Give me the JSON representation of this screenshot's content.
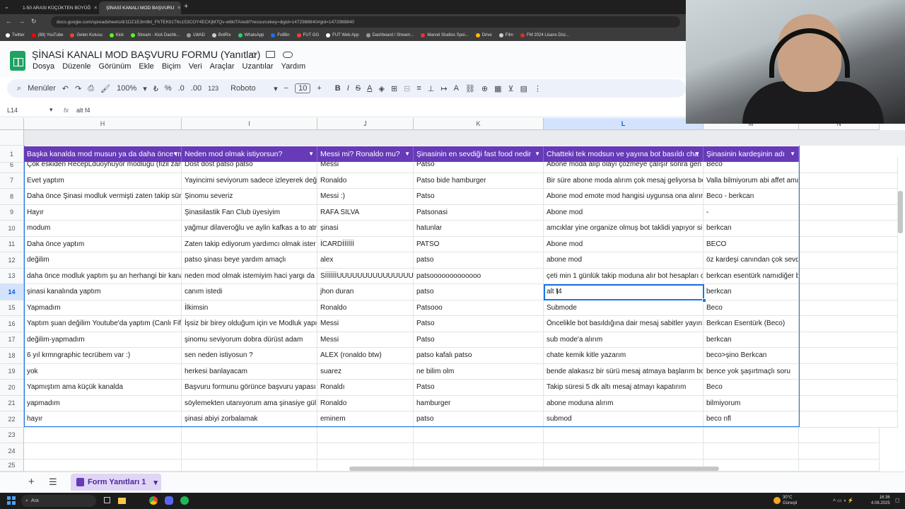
{
  "browser": {
    "tabs": [
      {
        "label": "1-50 ARASI KÜÇÜKTEN BÜYÜĞ",
        "active": false
      },
      {
        "label": "ŞİNASİ KANALI MOD BAŞVURU",
        "active": true
      }
    ],
    "url": "docs.google.com/spreadsheets/d/1DZ1E3m9kt_FhTEKlt1T6s153COY4ECKjM7Qv-w6kITA/edit?resourcekey=&gid=1472988840#gid=1472988840",
    "bookmarks": [
      {
        "label": "Twitter",
        "color": "#ffffff"
      },
      {
        "label": "(88) YouTube",
        "color": "#ff0000"
      },
      {
        "label": "Gelen Kutusu",
        "color": "#ea4335"
      },
      {
        "label": "Kick",
        "color": "#53fc18"
      },
      {
        "label": "Stream - Kick Dashb...",
        "color": "#53fc18"
      },
      {
        "label": "LWAD",
        "color": "#999999"
      },
      {
        "label": "BotRix",
        "color": "#cccccc"
      },
      {
        "label": "WhatsApp",
        "color": "#25d366"
      },
      {
        "label": "FutBin",
        "color": "#1f6feb"
      },
      {
        "label": "FUT GG",
        "color": "#ff3b30"
      },
      {
        "label": "FUT Web App",
        "color": "#ffffff"
      },
      {
        "label": "Dashboard / Stream...",
        "color": "#999999"
      },
      {
        "label": "Marvel Studios Spoi...",
        "color": "#e23636"
      },
      {
        "label": "Drive",
        "color": "#fbbc04"
      },
      {
        "label": "Film",
        "color": "#cccccc"
      },
      {
        "label": "FM 2024 Lisans Düz...",
        "color": "#d93025"
      }
    ]
  },
  "sheets": {
    "title": "ŞİNASİ KANALI MOD BAŞVURU FORMU (Yanıtlar)",
    "menu": [
      "Dosya",
      "Düzenle",
      "Görünüm",
      "Ekle",
      "Biçim",
      "Veri",
      "Araçlar",
      "Uzantılar",
      "Yardım"
    ],
    "toolbar": {
      "menus_label": "Menüler",
      "zoom": "100%",
      "currency": "₺",
      "percent": "%",
      "dec_less": ".0",
      "dec_more": ".00",
      "number_format": "123",
      "font": "Roboto",
      "font_size": "10"
    },
    "cell_ref": "L14",
    "formula_value": "alt f4",
    "columns": [
      "H",
      "I",
      "J",
      "K",
      "L",
      "M",
      "N"
    ],
    "headers": [
      "Başka kanalda mod musun ya da daha önce m",
      "Neden mod olmak istiyorsun?",
      "Messi mi? Ronaldo mu?",
      "Şinasinin en sevdiği fast food nedir",
      "Chatteki tek modsun ve yayına bot basıldı cha",
      "Şinasinin kardeşinin adı"
    ],
    "rows": [
      {
        "n": "6",
        "cells": [
          "Çok eskiden RecepLdüoyhuyor modluğu (fizil zam",
          "Dost dost patso patso",
          "Messi",
          "Patso",
          "Abone moda alıp olayı çözmeye çalışır sonra gen",
          "Beco"
        ]
      },
      {
        "n": "7",
        "cells": [
          "Evet yaptım",
          "Yayincimi seviyorum sadece izleyerek değ",
          "Ronaldo",
          "Patso bide hamburger",
          "Bir süre abone moda alırım çok mesaj geliyorsa bo",
          "Valla bilmiyorum abi affet ama"
        ]
      },
      {
        "n": "8",
        "cells": [
          "Daha önce Şinasi modluk vermişti zaten takip süre",
          "Şinomu severiz",
          "Messi :)",
          "Patso",
          "Abone mod emote mod hangisi uygunsa ona alırır",
          "Beco - berkcan"
        ]
      },
      {
        "n": "9",
        "cells": [
          "Hayır",
          "Şinasilastik Fan Club üyesiyim",
          "RAFA SILVA",
          "Patsonasi",
          "Abone mod",
          "-"
        ]
      },
      {
        "n": "10",
        "cells": [
          "modum",
          "yağmur dilaveroğlu ve aylin kafkas a to atr",
          "şinasi",
          "hatunlar",
          "amcıklar yine organize olmuş bot taklidi yapıyor si",
          "berkcan"
        ]
      },
      {
        "n": "11",
        "cells": [
          "Daha önce yaptım",
          "Zaten takip ediyorum yardımcı olmak ister",
          "İCARDİİİİİİ",
          "PATSO",
          "Abone mod",
          "BECO"
        ]
      },
      {
        "n": "12",
        "cells": [
          "değilim",
          "patso şinası beye yardım amaçlı",
          "alex",
          "patso",
          "abone mod",
          "öz kardeşi canından çok sevdi"
        ]
      },
      {
        "n": "13",
        "cells": [
          "daha önce modluk yaptım şu an herhangi bir kana",
          "neden mod olmak istemiyim haci yargı da",
          "SİİİİİİUUUUUUUUUUUUUUUUU",
          "patsooooooooooooo",
          "çeti min 1 günlük takip moduna alır bot hesapları c",
          "berkcan esentürk namıdiğer be"
        ]
      },
      {
        "n": "14",
        "cells": [
          "şinasi kanalında yaptım",
          "canım istedi",
          "jhon duran",
          "patso",
          "alt f4",
          "berkcan"
        ]
      },
      {
        "n": "15",
        "cells": [
          "Yapmadım",
          "İlkimsin",
          "Ronaldo",
          "Patsooo",
          "Submode",
          "Beco"
        ]
      },
      {
        "n": "16",
        "cells": [
          "Yaptım şuan değilim Youtube'da yaptım (Canlı Fifa",
          "İşsiz bir birey olduğum için ve Modluk yapı",
          "Messi",
          "Patso",
          "Öncelikle bot basıldığına dair mesaj sabitler yayını",
          "Berkcan Esentürk (Beco)"
        ]
      },
      {
        "n": "17",
        "cells": [
          "değilim-yapmadım",
          "şinomu seviyorum dobra dürüst adam",
          "Messi",
          "Patso",
          "sub mode'a alırım",
          "berkcan"
        ]
      },
      {
        "n": "18",
        "cells": [
          "6 yıl krmngraphic tecrübem var :)",
          "sen neden istiyosun ?",
          "ALEX (ronaldo btw)",
          "patso kafalı patso",
          "chate kemik kitle yazarım",
          "beco>şino Berkcan"
        ]
      },
      {
        "n": "19",
        "cells": [
          "yok",
          "herkesi banlayacam",
          "suarez",
          "ne bilim olm",
          "bende alakasız bir sürü mesaj atmaya başlarım bo",
          "bence yok şaşırtmaçlı soru"
        ]
      },
      {
        "n": "20",
        "cells": [
          "Yapmıştım ama küçük kanalda",
          "Başvuru formunu görünce başvuru yapası",
          "Ronaldı",
          "Patso",
          "Takip süresi 5 dk altı mesaj atmayı kapatırım",
          "Beco"
        ]
      },
      {
        "n": "21",
        "cells": [
          "yapmadım",
          "söylemekten utanıyorum ama şinasiye gül",
          "Ronaldo",
          "hamburger",
          "abone moduna alırım",
          "bilmiyorum"
        ]
      },
      {
        "n": "22",
        "cells": [
          "hayır",
          "şinasi abiyi zorbalamak",
          "eminem",
          "patso",
          "submod",
          "beco nfl"
        ]
      }
    ],
    "empty_rows": [
      "23",
      "24",
      "25"
    ],
    "header_row_num": "1",
    "selected_row": "14",
    "selected_col": "L",
    "sheet_tab": "Form Yanıtları 1",
    "header_color": "#673ab7"
  },
  "taskbar": {
    "search": "Ara",
    "weather_temp": "30°C",
    "weather_desc": "Güneşli",
    "time": "16:36",
    "date": "4.08.2025"
  }
}
